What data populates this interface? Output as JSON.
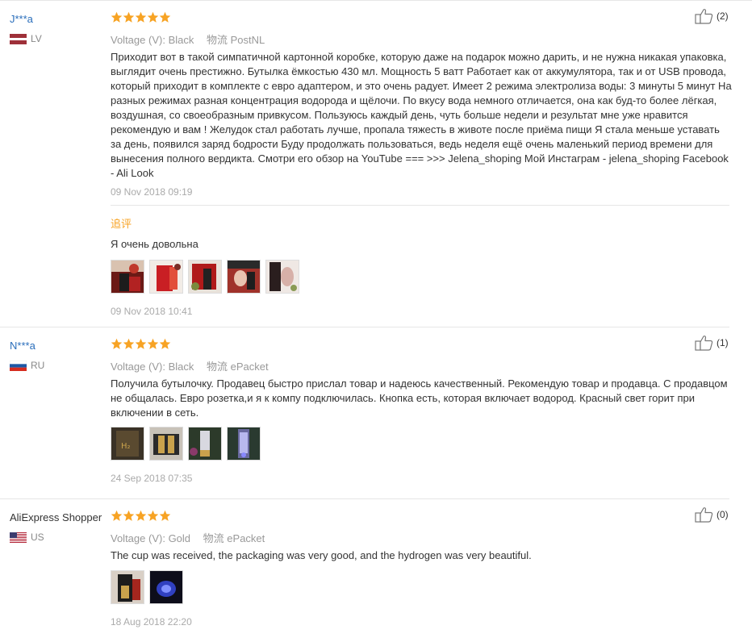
{
  "reviews": [
    {
      "user": "J***a",
      "country": "LV",
      "rating": 5,
      "attr_label": "Voltage (V):",
      "attr_value": "Black",
      "shipping_label": "物流",
      "shipping_value": "PostNL",
      "likes": "(2)",
      "text": "Приходит вот в такой симпатичной картонной коробке, которую даже на подарок можно дарить, и не нужна никакая упаковка, выглядит очень престижно. Бутылка ёмкостью 430 мл. Мощность 5 ватт Работает как от аккумулятора, так и от USB провода, который приходит в комплекте с евро адаптером, и это очень радует. Имеет 2 режима электролиза воды: 3 минуты 5 минут На разных режимах разная концентрация водорода и щёлочи. По вкусу вода немного отличается, она как буд-то более лёгкая, воздушная, со своеобразным привкусом. Пользуюсь каждый день, чуть больше недели и результат мне уже нравится рекомендую и вам ! Желудок стал работать лучше, пропала тяжесть в животе после приёма пищи Я стала меньше уставать за день, появился заряд бодрости Буду продолжать пользоваться, ведь неделя ещё очень маленький период времени для вынесения полного вердикта. Смотри его обзор на YouTube === >>> Jelena_shoping Мой Инстаграм - jelena_shoping Facebook - Ali Look",
      "date": "09 Nov 2018 09:19",
      "additional_title": "追评",
      "additional_text": "Я очень довольна",
      "additional_date": "09 Nov 2018 10:41",
      "thumbs": [
        "photo-1",
        "photo-2",
        "photo-3",
        "photo-4",
        "photo-5"
      ]
    },
    {
      "user": "N***a",
      "country": "RU",
      "rating": 5,
      "attr_label": "Voltage (V):",
      "attr_value": "Black",
      "shipping_label": "物流",
      "shipping_value": "ePacket",
      "likes": "(1)",
      "text": "Получила бутылочку. Продавец быстро прислал товар и надеюсь качественный. Рекомендую товар и продавца. С продавцом не общалась. Евро розетка,и я к компу подключилась. Кнопка есть, которая включает водород. Красный свет горит при включении в сеть.",
      "date": "24 Sep 2018 07:35",
      "thumbs": [
        "photo-1",
        "photo-2",
        "photo-3",
        "photo-4"
      ]
    },
    {
      "user": "AliExpress Shopper",
      "country": "US",
      "rating": 5,
      "attr_label": "Voltage (V):",
      "attr_value": "Gold",
      "shipping_label": "物流",
      "shipping_value": "ePacket",
      "likes": "(0)",
      "text": "The cup was received, the packaging was very good, and the hydrogen was very beautiful.",
      "date": "18 Aug 2018 22:20",
      "thumbs": [
        "photo-1",
        "photo-2"
      ]
    }
  ],
  "colors": {
    "username": "#2a6ebb",
    "star": "#f7a324",
    "muted": "#999999",
    "date": "#aaaaaa",
    "additional_title": "#f7a324"
  },
  "icons": {
    "star": "star-icon",
    "like": "thumbs-up-icon",
    "flag_lv": "latvia-flag-icon",
    "flag_ru": "russia-flag-icon",
    "flag_us": "usa-flag-icon"
  }
}
